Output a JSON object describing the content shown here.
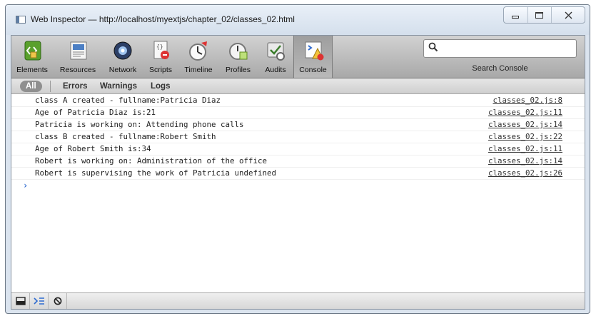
{
  "window": {
    "title": "Web Inspector — http://localhost/myextjs/chapter_02/classes_02.html"
  },
  "toolbar": {
    "items": [
      {
        "label": "Elements",
        "icon": "elements-icon"
      },
      {
        "label": "Resources",
        "icon": "resources-icon"
      },
      {
        "label": "Network",
        "icon": "network-icon"
      },
      {
        "label": "Scripts",
        "icon": "scripts-icon"
      },
      {
        "label": "Timeline",
        "icon": "timeline-icon"
      },
      {
        "label": "Profiles",
        "icon": "profiles-icon"
      },
      {
        "label": "Audits",
        "icon": "audits-icon"
      },
      {
        "label": "Console",
        "icon": "console-icon"
      }
    ],
    "selected": "Console"
  },
  "search": {
    "placeholder": "",
    "label": "Search Console"
  },
  "scopebar": {
    "all": "All",
    "errors": "Errors",
    "warnings": "Warnings",
    "logs": "Logs",
    "active": "All"
  },
  "console": {
    "messages": [
      {
        "text": "class A created - fullname:Patricia Diaz",
        "source": "classes_02.js:8"
      },
      {
        "text": "Age of Patricia Diaz is:21",
        "source": "classes_02.js:11"
      },
      {
        "text": "Patricia is working on: Attending phone calls",
        "source": "classes_02.js:14"
      },
      {
        "text": "class B created - fullname:Robert Smith",
        "source": "classes_02.js:22"
      },
      {
        "text": "Age of Robert Smith is:34",
        "source": "classes_02.js:11"
      },
      {
        "text": "Robert is working on: Administration of the office",
        "source": "classes_02.js:14"
      },
      {
        "text": "Robert is supervising the work of Patricia undefined",
        "source": "classes_02.js:26"
      }
    ],
    "prompt": "›"
  },
  "statusbar": {
    "buttons": [
      "dock-icon",
      "console-toggle-icon",
      "clear-console-icon"
    ]
  },
  "colors": {
    "accent": "#2f6bd0",
    "toolbar_top": "#d2d2d2",
    "toolbar_bottom": "#a8a8a8"
  }
}
